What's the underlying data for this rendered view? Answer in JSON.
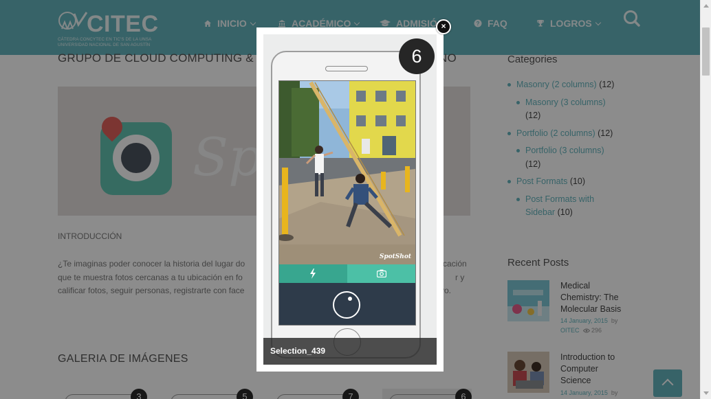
{
  "header": {
    "logo": {
      "title": "CITEC",
      "subtitle_line1": "CÁTEDRA CONCYTEC EN TIC'S DE LA UNSA",
      "subtitle_line2": "UNIVERSIDAD NACIONAL DE SAN AGUSTÍN"
    },
    "nav": [
      {
        "label": "INICIO",
        "icon": "home-icon",
        "has_dropdown": true
      },
      {
        "label": "ACADÉMICO",
        "icon": "bank-icon",
        "has_dropdown": true
      },
      {
        "label": "ADMISIÓ",
        "icon": "graduation-cap-icon",
        "has_dropdown": false
      },
      {
        "label": "FAQ",
        "icon": "question-circle-icon",
        "has_dropdown": false
      },
      {
        "label": "LOGROS",
        "icon": "trophy-icon",
        "has_dropdown": true
      }
    ],
    "search_icon": "search-icon"
  },
  "main": {
    "post_title": "GRUPO DE CLOUD COMPUTING & CO",
    "post_title_tail": "NO",
    "hero_text": "Spo",
    "intro_heading": "INTRODUCCIÓN",
    "intro_lines": [
      "¿Te imaginas poder conocer la historia del lugar do",
      "que te muestra fotos cercanas a tu ubicación en fo",
      "calificar fotos, seguir personas, registrarte con face"
    ],
    "intro_line_tails": [
      "cación",
      "r y",
      "vo."
    ],
    "gallery_title": "GALERIA DE IMÁGENES",
    "gallery_badges": [
      "3",
      "5",
      "7",
      "6"
    ]
  },
  "sidebar": {
    "categories_title": "Categories",
    "categories": [
      {
        "name": "Masonry (2 columns)",
        "count": "(12)",
        "sub": false,
        "wrap": false
      },
      {
        "name": "Masonry (3 columns)",
        "count": "(12)",
        "sub": true,
        "wrap": true
      },
      {
        "name": "Portfolio (2 columns)",
        "count": "(12)",
        "sub": false,
        "wrap": false
      },
      {
        "name": "Portfolio (3 columns)",
        "count": "(12)",
        "sub": true,
        "wrap": true
      },
      {
        "name": "Post Formats",
        "count": "(10)",
        "sub": false,
        "wrap": false
      },
      {
        "name": "Post Formats with Sidebar",
        "count": "(10)",
        "sub": true,
        "wrap": false
      }
    ],
    "recent_posts_title": "Recent Posts",
    "recent_posts": [
      {
        "title": "Medical Chemistry: The Molecular Basis",
        "date": "14 January, 2015",
        "by": "by",
        "author": "OITEC",
        "views": "296"
      },
      {
        "title": "Introduction to Computer Science",
        "date": "14 January, 2015",
        "by": "by",
        "author": "",
        "views": ""
      }
    ]
  },
  "lightbox": {
    "caption": "Selection_439",
    "badge_number": "6",
    "watermark": "SpotShot",
    "close_label": "×"
  },
  "colors": {
    "brand": "#64b5be",
    "spotshot_green": "#38a68f",
    "spotshot_light_green": "#4cc0a6",
    "spotshot_dark": "#2e3b4a",
    "overlay": "rgba(0,0,0,0.45)"
  }
}
